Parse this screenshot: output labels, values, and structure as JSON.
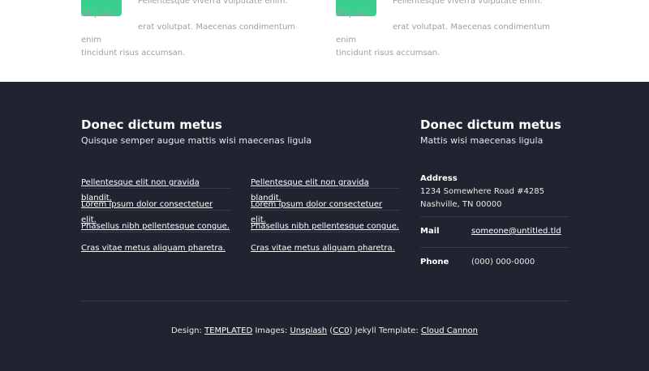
{
  "features": [
    {
      "icon": "square-icon",
      "text_line1": "Pellentesque viverra vulputate enim. Aliquam",
      "text_line2": "erat volutpat. Maecenas condimentum enim",
      "text_line3": "tincidunt risus accumsan."
    },
    {
      "icon": "square-icon",
      "text_line1": "Pellentesque viverra vulputate enim. Aliquam",
      "text_line2": "erat volutpat. Maecenas condimentum enim",
      "text_line3": "tincidunt risus accumsan."
    }
  ],
  "footer": {
    "left": {
      "title": "Donec dictum metus",
      "subtitle": "Quisque semper augue mattis wisi maecenas ligula",
      "links_col1": [
        "Pellentesque elit non gravida blandit.",
        "Lorem ipsum dolor consectetuer elit.",
        "Phasellus nibh pellentesque congue.",
        "Cras vitae metus aliquam pharetra."
      ],
      "links_col2": [
        "Pellentesque elit non gravida blandit.",
        "Lorem ipsum dolor consectetuer elit.",
        "Phasellus nibh pellentesque congue.",
        "Cras vitae metus aliquam pharetra."
      ]
    },
    "right": {
      "title": "Donec dictum metus",
      "subtitle": "Mattis wisi maecenas ligula",
      "address_label": "Address",
      "address_line1": "1234 Somewhere Road #4285",
      "address_line2": "Nashville, TN 00000",
      "mail_label": "Mail",
      "mail_value": "someone@untitled.tld",
      "phone_label": "Phone",
      "phone_value": "(000) 000-0000"
    },
    "credits": {
      "design_label": "Design:",
      "design_link": "TEMPLATED",
      "images_label": "Images:",
      "images_link": "Unsplash",
      "license_link": "CC0",
      "jekyll_label": "Jekyll Template:",
      "jekyll_link": "Cloud Cannon"
    }
  },
  "colors": {
    "accent": "#3bcf8e",
    "footer_bg": "#1f2430"
  }
}
